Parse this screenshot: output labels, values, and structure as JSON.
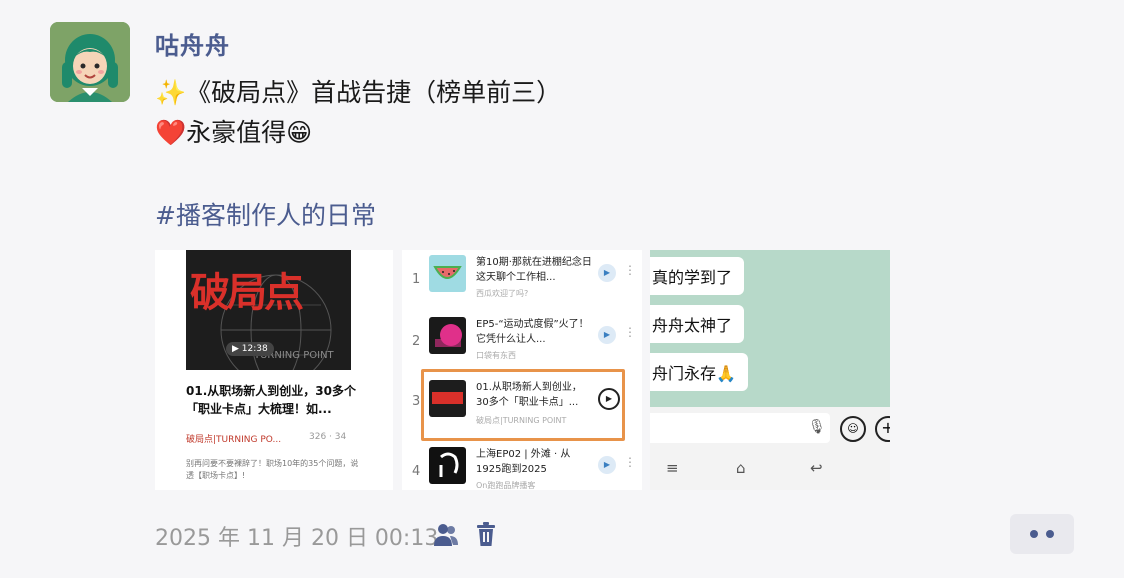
{
  "post": {
    "username": "咕舟舟",
    "line1": "✨《破局点》首战告捷（榜单前三）",
    "line2": "❤️永豪值得😁",
    "hashtag": "#播客制作人的日常",
    "timestamp": "2025 年 11 月 20 日 00:13"
  },
  "photo1": {
    "cover_title": "破局点",
    "cover_subtitle": "TURNING POINT",
    "duration": "12:38",
    "episode_title": "01.从职场新人到创业，30多个「职业卡点」大梳理！如...",
    "podcast": "破局点|TURNING PO...",
    "stats": "326 · 34",
    "description": "别再问要不要裸辞了！职场10年的35个问题，说透【职场卡点】!"
  },
  "photo2": {
    "rows": [
      {
        "num": "1",
        "title": "第10期·那就在进棚纪念日这天聊个工作相...",
        "sub": "西瓜欢迎了吗?"
      },
      {
        "num": "2",
        "title": "EP5-“运动式度假”火了！它凭什么让人...",
        "sub": "口袋有东西"
      },
      {
        "num": "3",
        "title": "01.从职场新人到创业，30多个「职业卡点」...",
        "sub": "破局点|TURNING POINT"
      },
      {
        "num": "4",
        "title": "上海EP02 | 外滩 · 从1925跑到2025",
        "sub": "On跑跑品牌播客"
      }
    ]
  },
  "photo3": {
    "messages": [
      "真的学到了",
      "舟舟太神了",
      "舟门永存🙏"
    ]
  },
  "colors": {
    "link": "#4b5c8f",
    "highlight": "#e8934a",
    "chat_bg": "#b7d9c9"
  }
}
